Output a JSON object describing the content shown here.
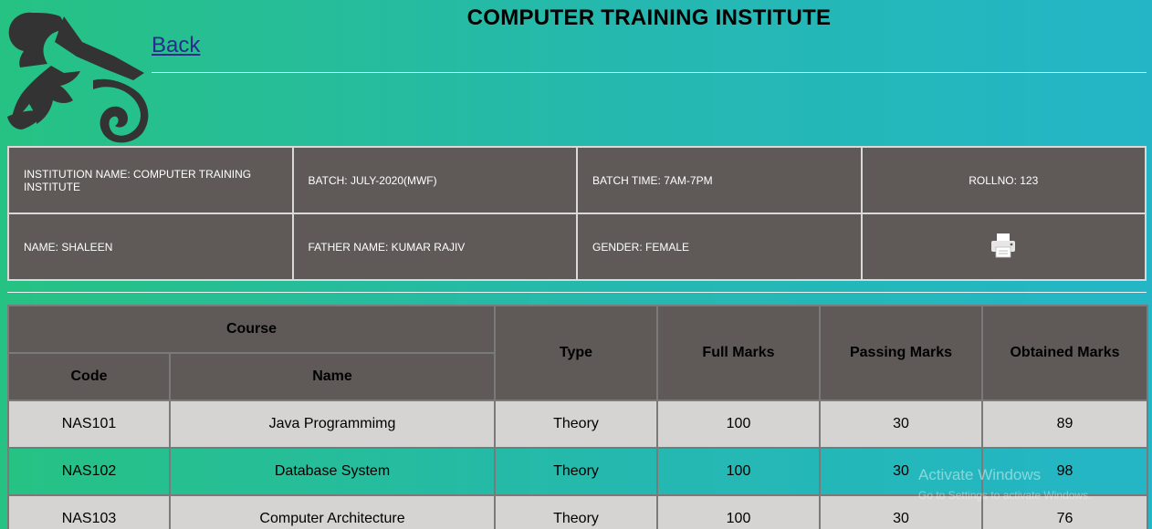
{
  "header": {
    "title": "COMPUTER TRAINING INSTITUTE",
    "back_label": "Back",
    "logo_icon": "scroll-logo-icon"
  },
  "info": {
    "institution": "INSTITUTION NAME: COMPUTER TRAINING INSTITUTE",
    "batch": "BATCH: JULY-2020(MWF)",
    "batch_time": "BATCH TIME: 7AM-7PM",
    "rollno": "ROLLNO: 123",
    "name": "NAME: SHALEEN",
    "father_name": "FATHER NAME: KUMAR RAJIV",
    "gender": "GENDER: FEMALE",
    "print_icon": "printer-icon"
  },
  "marks_table": {
    "headers": {
      "course": "Course",
      "code": "Code",
      "name": "Name",
      "type": "Type",
      "full_marks": "Full Marks",
      "passing_marks": "Passing Marks",
      "obtained_marks": "Obtained Marks"
    },
    "rows": [
      {
        "code": "NAS101",
        "name": "Java Programmimg",
        "type": "Theory",
        "full": "100",
        "pass": "30",
        "obtained": "89"
      },
      {
        "code": "NAS102",
        "name": "Database System",
        "type": "Theory",
        "full": "100",
        "pass": "30",
        "obtained": "98"
      },
      {
        "code": "NAS103",
        "name": "Computer Architecture",
        "type": "Theory",
        "full": "100",
        "pass": "30",
        "obtained": "76"
      }
    ]
  },
  "watermark": {
    "line1": "Activate Windows",
    "line2": "Go to Settings to activate Windows."
  },
  "colors": {
    "gradient_start": "#26c283",
    "gradient_end": "#24b6c6",
    "panel": "#5f5a58",
    "row_light": "#d6d4d3"
  }
}
